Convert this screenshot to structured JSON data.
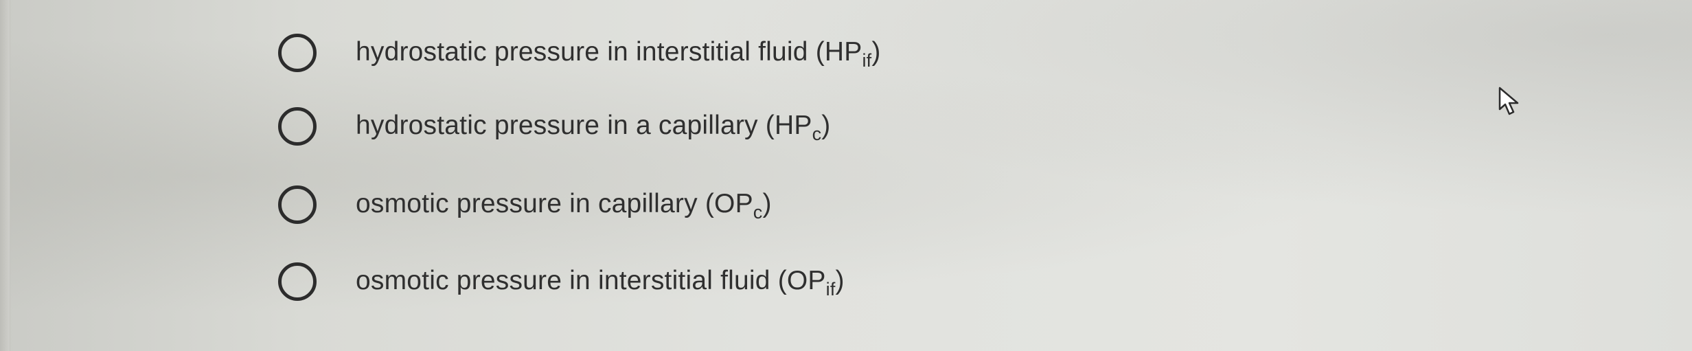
{
  "question": {
    "options": [
      {
        "text": "hydrostatic pressure in interstitial fluid (HP",
        "sub": "if",
        "close": ")"
      },
      {
        "text": "hydrostatic pressure in a capillary (HP",
        "sub": "c",
        "close": ")"
      },
      {
        "text": "osmotic pressure in capillary (OP",
        "sub": "c",
        "close": ")"
      },
      {
        "text": "osmotic pressure in interstitial fluid (OP",
        "sub": "if",
        "close": ")"
      }
    ]
  },
  "colors": {
    "text": "#2f2f2f",
    "radio_border": "#2c2c2c",
    "background": "#e1e2de"
  },
  "icons": {
    "cursor": "arrow-cursor-icon"
  }
}
